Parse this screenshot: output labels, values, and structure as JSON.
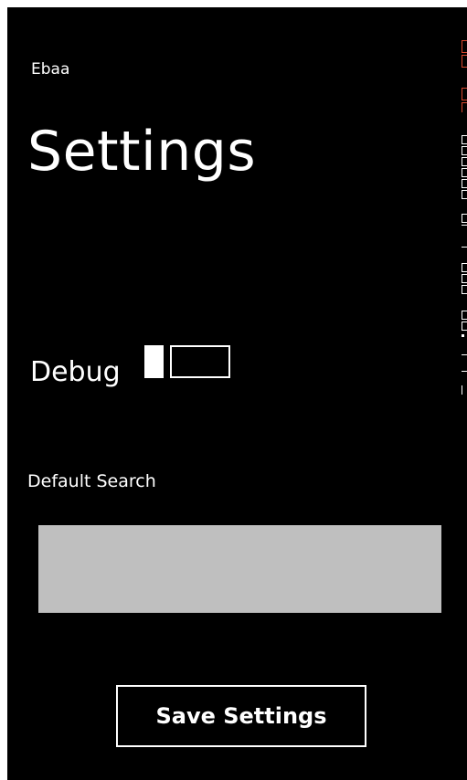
{
  "app": {
    "name": "Ebaa"
  },
  "page": {
    "title": "Settings"
  },
  "debug": {
    "label": "Debug",
    "enabled": false
  },
  "default_search": {
    "label": "Default Search",
    "value": ""
  },
  "actions": {
    "save_label": "Save Settings"
  },
  "colors": {
    "background": "#000000",
    "foreground": "#ffffff",
    "input_background": "#bfbfbf",
    "edge_accent": "#d9462e"
  }
}
